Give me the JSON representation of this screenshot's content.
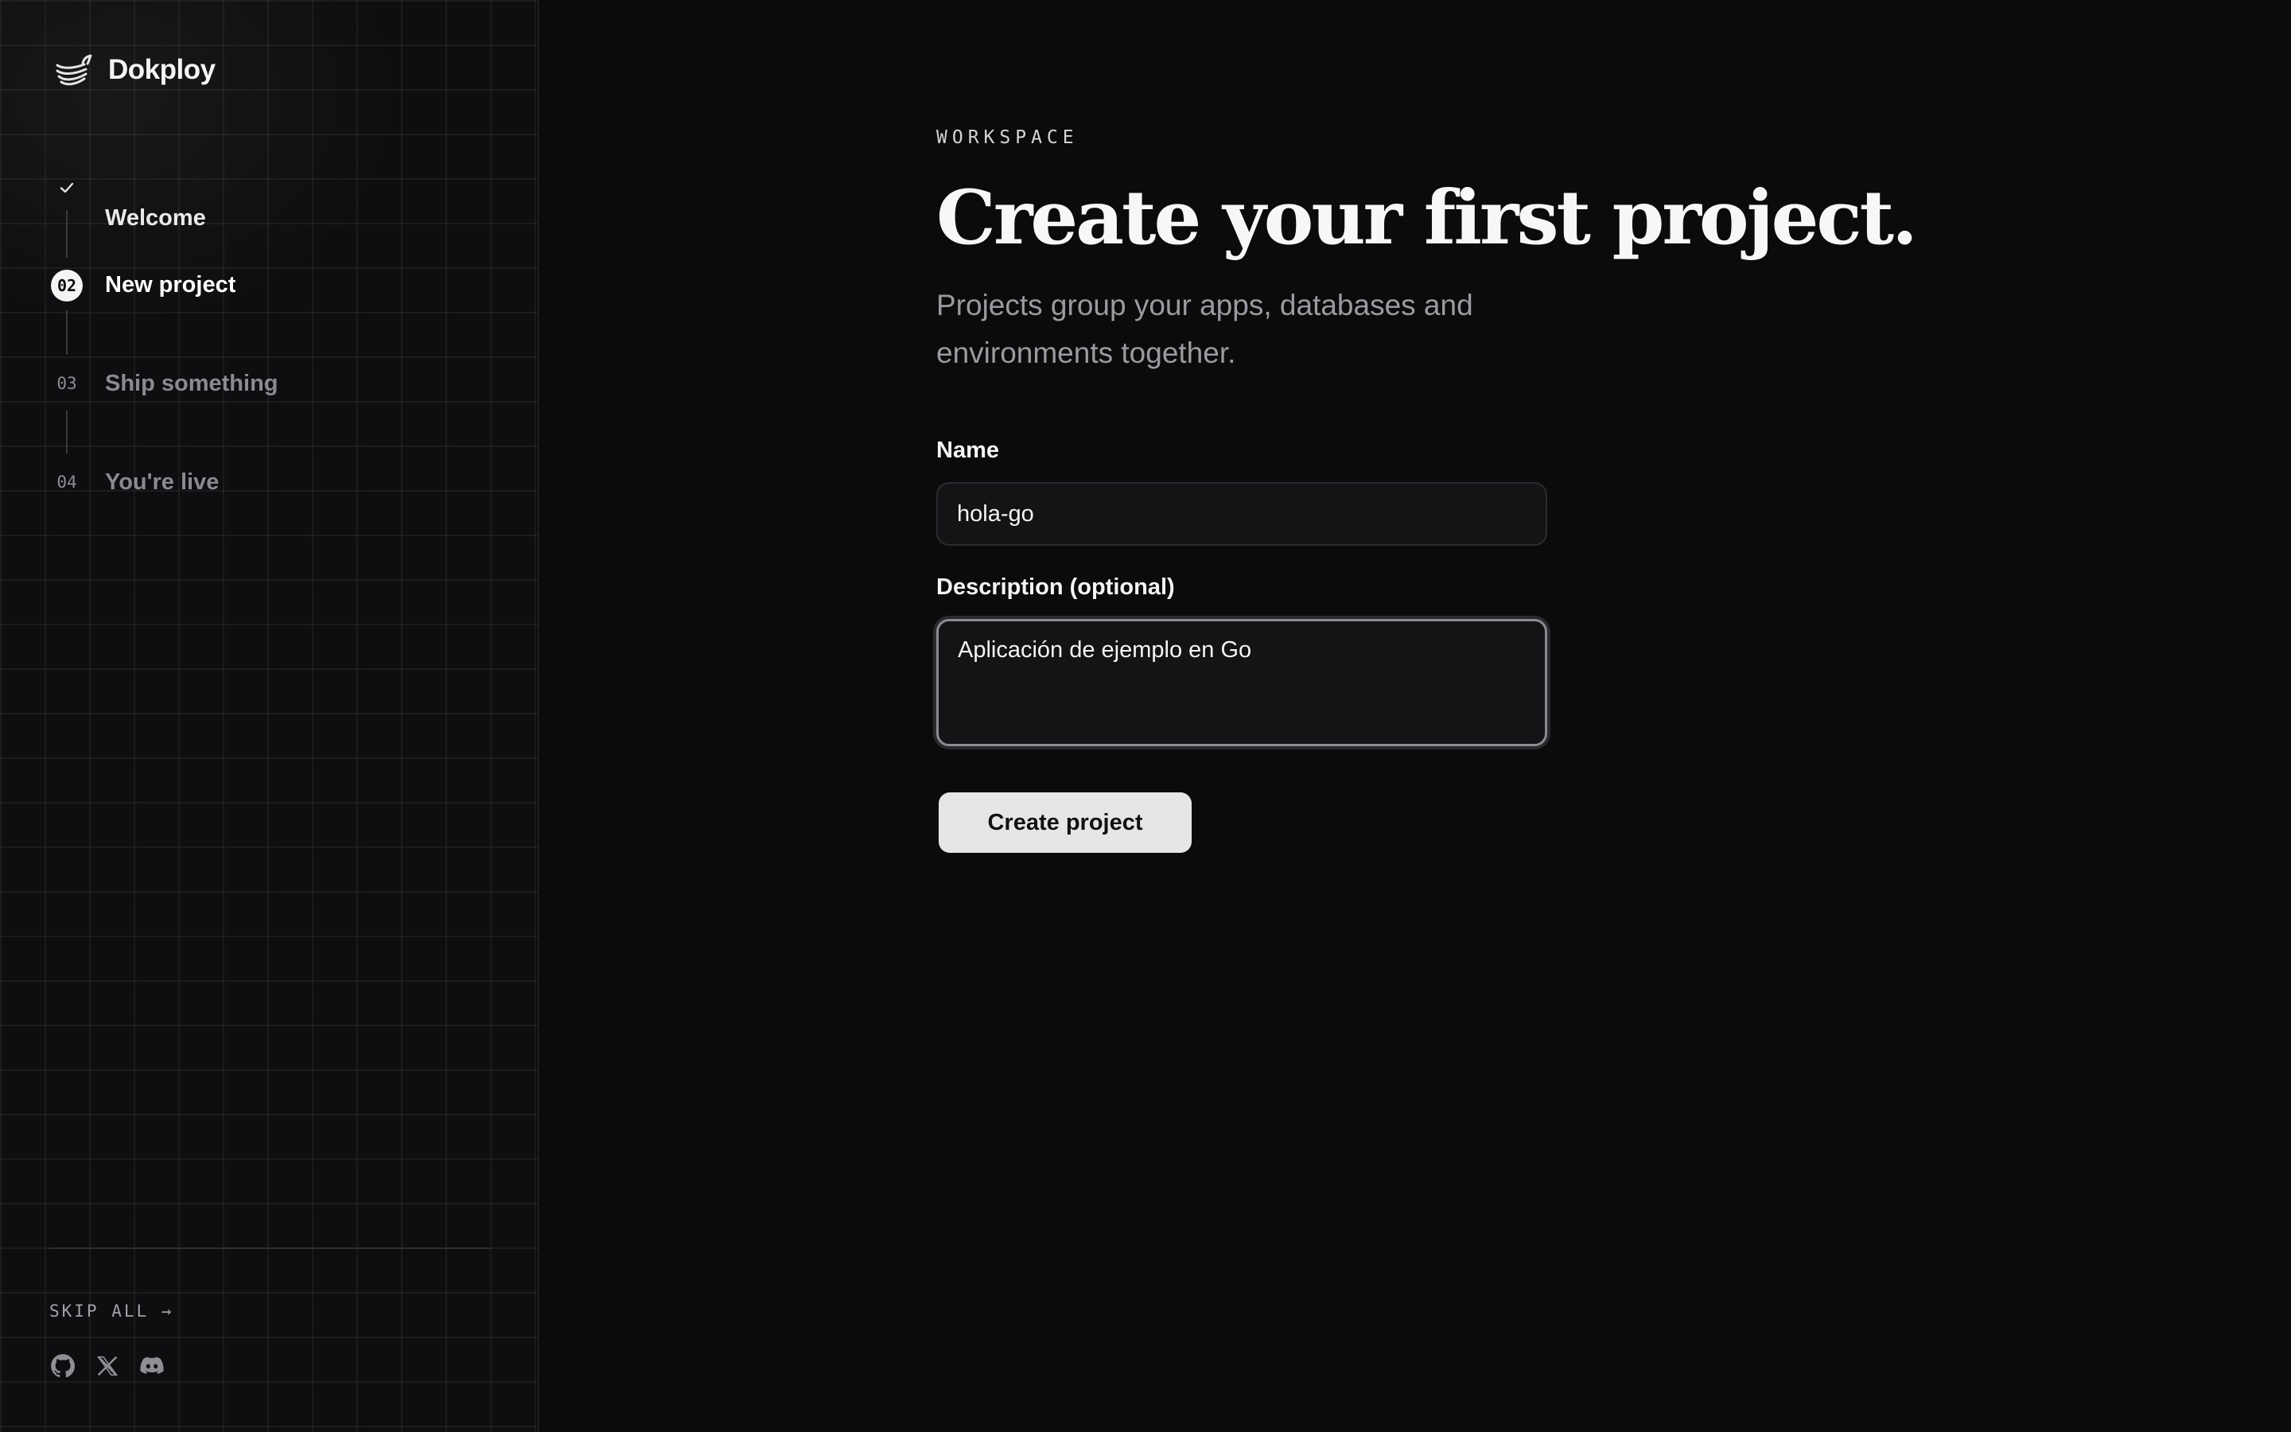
{
  "brand": {
    "name": "Dokploy",
    "logo_icon": "dokploy-whale-logo"
  },
  "steps": [
    {
      "marker": "✓",
      "label": "Welcome",
      "state": "done"
    },
    {
      "marker": "02",
      "label": "New project",
      "state": "active"
    },
    {
      "marker": "03",
      "label": "Ship something",
      "state": "pending"
    },
    {
      "marker": "04",
      "label": "You're live",
      "state": "pending"
    }
  ],
  "sidebar_footer": {
    "skip_label": "SKIP ALL →",
    "social_icons": [
      "github-icon",
      "x-icon",
      "discord-icon"
    ]
  },
  "main": {
    "eyebrow": "WORKSPACE",
    "title": "Create your first project.",
    "subtitle": "Projects group your apps, databases and environments together.",
    "name_label": "Name",
    "name_value": "hola-go",
    "description_label": "Description (optional)",
    "description_value": "Aplicación de ejemplo en Go",
    "submit_label": "Create project"
  },
  "colors": {
    "background": "#0b0b0c",
    "sidebar": "#0e0e10",
    "button": "#e6e6e8",
    "muted_text": "#9a9aa0"
  }
}
